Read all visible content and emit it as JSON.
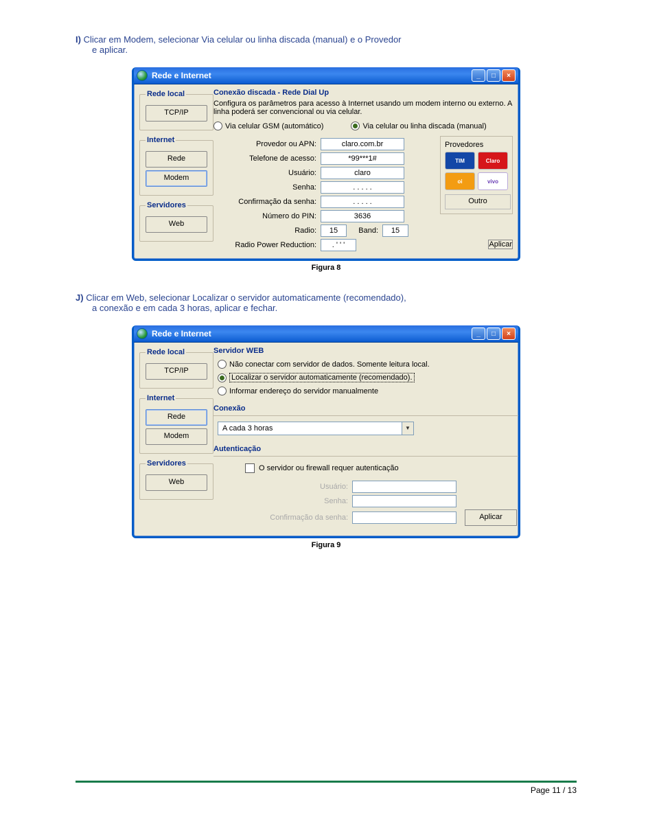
{
  "step_i": {
    "letter": "I)",
    "text_a": "Clicar em Modem, selecionar Via celular ou linha discada (manual) e o Provedor",
    "text_b": "e aplicar."
  },
  "step_j": {
    "letter": "J)",
    "text_a": "Clicar em Web, selecionar Localizar o servidor automaticamente (recomendado),",
    "text_b": "a conexão e em cada 3 horas, aplicar e fechar."
  },
  "captions": {
    "fig8": "Figura 8",
    "fig9": "Figura 9"
  },
  "footer": {
    "text": "Page 11 / 13"
  },
  "win": {
    "title": "Rede e Internet",
    "groups": {
      "rede_local": "Rede local",
      "internet": "Internet",
      "servidores": "Servidores"
    },
    "side": {
      "tcpip": "TCP/IP",
      "rede": "Rede",
      "modem": "Modem",
      "web": "Web"
    },
    "apply": "Aplicar"
  },
  "fig8": {
    "panel_title": "Conexão discada - Rede Dial Up",
    "desc": "Configura os parâmetros para acesso à Internet usando um modem interno ou externo. A linha poderá ser convencional ou via celular.",
    "radio_auto": "Via celular GSM (automático)",
    "radio_manual": "Via celular ou linha discada (manual)",
    "labels": {
      "provedor": "Provedor ou APN:",
      "telefone": "Telefone de acesso:",
      "usuario": "Usuário:",
      "senha": "Senha:",
      "confirma": "Confirmação da senha:",
      "pin": "Número do PIN:",
      "radio": "Radio:",
      "band": "Band:",
      "rpr": "Radio Power Reduction:"
    },
    "values": {
      "provedor": "claro.com.br",
      "telefone": "*99***1#",
      "usuario": "claro",
      "senha": ". . . . .",
      "confirma": ". . . . .",
      "pin": "3636",
      "radio": "15",
      "band": "15",
      "rpr": ". ' ' '"
    },
    "prov_title": "Provedores",
    "providers": {
      "tim": "TIM",
      "claro": "Claro",
      "oi": "oi",
      "vivo": "vivo",
      "outro": "Outro"
    }
  },
  "fig9": {
    "panel_title": "Servidor WEB",
    "opt1": "Não conectar com servidor de dados. Somente leitura local.",
    "opt2": "Localizar o servidor automaticamente (recomendado).",
    "opt3": "Informar endereço do servidor manualmente",
    "conexao_title": "Conexão",
    "conexao_value": "A cada 3 horas",
    "auth_title": "Autenticação",
    "auth_check": "O servidor ou firewall requer autenticação",
    "auth_user": "Usuário:",
    "auth_pass": "Senha:",
    "auth_conf": "Confirmação da senha:"
  }
}
